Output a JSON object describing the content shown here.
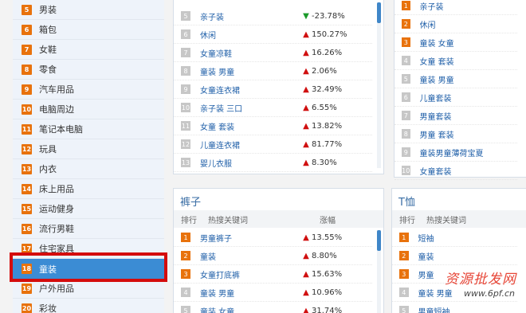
{
  "sidebar": {
    "items": [
      {
        "num": "5",
        "label": "男装"
      },
      {
        "num": "6",
        "label": "箱包"
      },
      {
        "num": "7",
        "label": "女鞋"
      },
      {
        "num": "8",
        "label": "零食"
      },
      {
        "num": "9",
        "label": "汽车用品"
      },
      {
        "num": "10",
        "label": "电脑周边"
      },
      {
        "num": "11",
        "label": "笔记本电脑"
      },
      {
        "num": "12",
        "label": "玩具"
      },
      {
        "num": "13",
        "label": "内衣"
      },
      {
        "num": "14",
        "label": "床上用品"
      },
      {
        "num": "15",
        "label": "运动健身"
      },
      {
        "num": "16",
        "label": "流行男鞋"
      },
      {
        "num": "17",
        "label": "住宅家具"
      },
      {
        "num": "18",
        "label": "童装"
      },
      {
        "num": "19",
        "label": "户外用品"
      },
      {
        "num": "20",
        "label": "彩妆"
      }
    ],
    "active_index": 13
  },
  "top_left_panel": {
    "rows": [
      {
        "rank": "5",
        "keyword": "亲子装",
        "change": "-23.78%",
        "dir": "down"
      },
      {
        "rank": "6",
        "keyword": "休闲",
        "change": "150.27%",
        "dir": "up"
      },
      {
        "rank": "7",
        "keyword": "女童凉鞋",
        "change": "16.26%",
        "dir": "up"
      },
      {
        "rank": "8",
        "keyword": "童装 男童",
        "change": "2.06%",
        "dir": "up"
      },
      {
        "rank": "9",
        "keyword": "女童连衣裙",
        "change": "32.49%",
        "dir": "up"
      },
      {
        "rank": "10",
        "keyword": "亲子装 三口",
        "change": "6.55%",
        "dir": "up"
      },
      {
        "rank": "11",
        "keyword": "女童 套装",
        "change": "13.82%",
        "dir": "up"
      },
      {
        "rank": "12",
        "keyword": "儿童连衣裙",
        "change": "81.77%",
        "dir": "up"
      },
      {
        "rank": "13",
        "keyword": "婴儿衣服",
        "change": "8.30%",
        "dir": "up"
      }
    ]
  },
  "top_right_panel": {
    "rows": [
      {
        "rank": "1",
        "keyword": "亲子装"
      },
      {
        "rank": "2",
        "keyword": "休闲"
      },
      {
        "rank": "3",
        "keyword": "童装 女童"
      },
      {
        "rank": "4",
        "keyword": "女童 套装"
      },
      {
        "rank": "5",
        "keyword": "童装 男童"
      },
      {
        "rank": "6",
        "keyword": "儿童套装"
      },
      {
        "rank": "7",
        "keyword": "男童套装"
      },
      {
        "rank": "8",
        "keyword": "男童 套装"
      },
      {
        "rank": "9",
        "keyword": "童装男童薄荷宝夏"
      },
      {
        "rank": "10",
        "keyword": "女童套装"
      }
    ]
  },
  "pants_panel": {
    "title": "裤子",
    "col_rank": "排行",
    "col_keyword": "热搜关键词",
    "col_change": "涨幅",
    "rows": [
      {
        "rank": "1",
        "keyword": "男童裤子",
        "change": "13.55%",
        "dir": "up"
      },
      {
        "rank": "2",
        "keyword": "童装",
        "change": "8.80%",
        "dir": "up"
      },
      {
        "rank": "3",
        "keyword": "女童打底裤",
        "change": "15.63%",
        "dir": "up"
      },
      {
        "rank": "4",
        "keyword": "童装 男童",
        "change": "10.96%",
        "dir": "up"
      },
      {
        "rank": "5",
        "keyword": "童装 女童",
        "change": "31.74%",
        "dir": "up"
      }
    ]
  },
  "tshirt_panel": {
    "title": "T恤",
    "col_rank": "排行",
    "col_keyword": "热搜关键词",
    "rows": [
      {
        "rank": "1",
        "keyword": "短袖"
      },
      {
        "rank": "2",
        "keyword": "童装"
      },
      {
        "rank": "3",
        "keyword": "男童"
      },
      {
        "rank": "4",
        "keyword": "童装 男童"
      },
      {
        "rank": "5",
        "keyword": "男童短袖"
      }
    ]
  },
  "watermark": {
    "text": "资源批发网",
    "url": "www.6pf.cn"
  },
  "colors": {
    "accent": "#3b8cd4",
    "rank_hot": "#e8720c",
    "highlight": "#d40c0c",
    "up": "#d01010",
    "down": "#1a9a2a"
  }
}
